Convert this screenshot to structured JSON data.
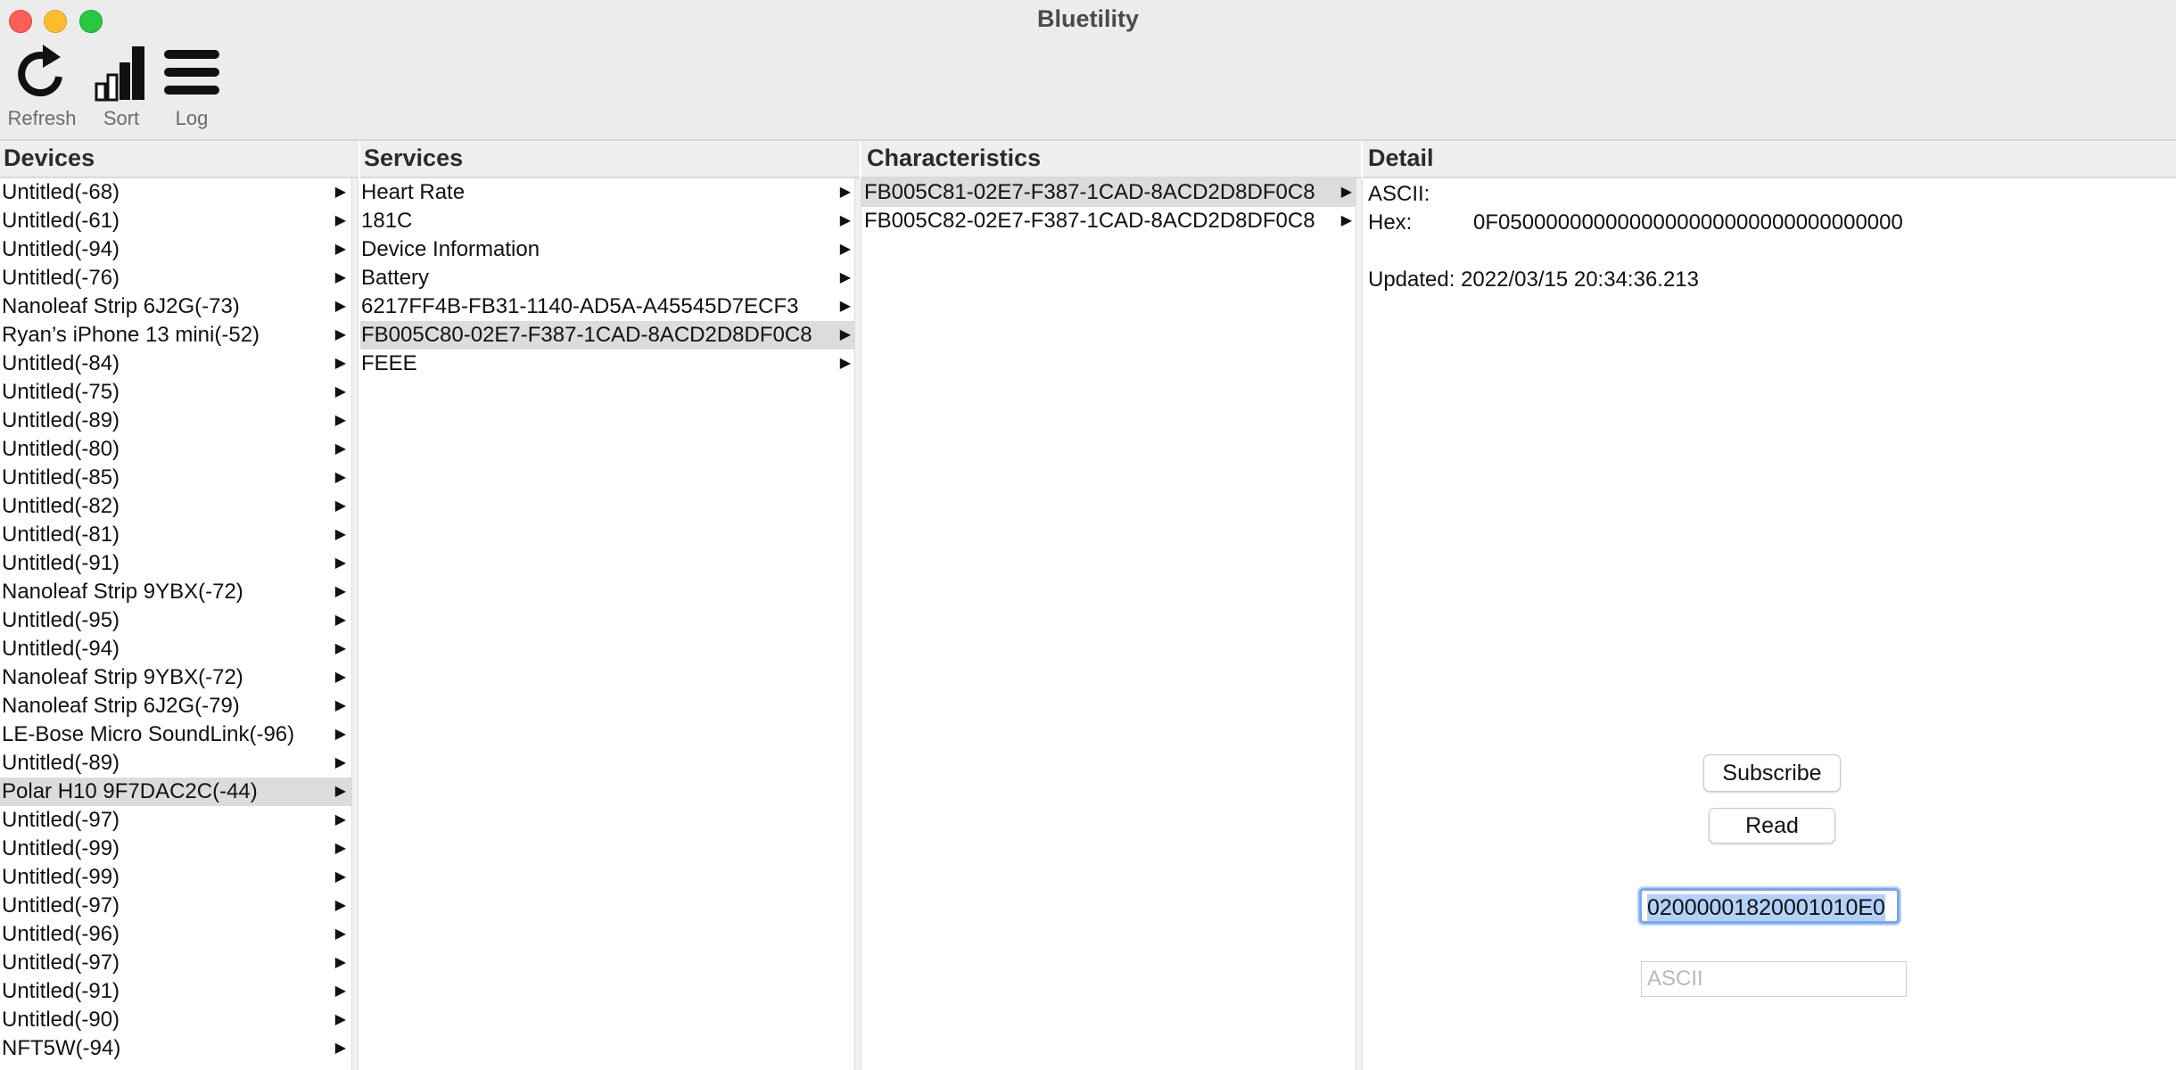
{
  "window": {
    "title": "Bluetility"
  },
  "toolbar": {
    "refresh_label": "Refresh",
    "sort_label": "Sort",
    "log_label": "Log"
  },
  "columns": {
    "devices": "Devices",
    "services": "Services",
    "characteristics": "Characteristics",
    "detail": "Detail"
  },
  "devices": [
    "Untitled(-68)",
    "Untitled(-61)",
    "Untitled(-94)",
    "Untitled(-76)",
    "Nanoleaf Strip 6J2G(-73)",
    "Ryan’s iPhone 13 mini(-52)",
    "Untitled(-84)",
    "Untitled(-75)",
    "Untitled(-89)",
    "Untitled(-80)",
    "Untitled(-85)",
    "Untitled(-82)",
    "Untitled(-81)",
    "Untitled(-91)",
    "Nanoleaf Strip 9YBX(-72)",
    "Untitled(-95)",
    "Untitled(-94)",
    "Nanoleaf Strip 9YBX(-72)",
    "Nanoleaf Strip 6J2G(-79)",
    "LE-Bose Micro SoundLink(-96)",
    "Untitled(-89)",
    "Polar H10 9F7DAC2C(-44)",
    "Untitled(-97)",
    "Untitled(-99)",
    "Untitled(-99)",
    "Untitled(-97)",
    "Untitled(-96)",
    "Untitled(-97)",
    "Untitled(-91)",
    "Untitled(-90)",
    "NFT5W(-94)"
  ],
  "devices_selected_index": 21,
  "services": [
    "Heart Rate",
    "181C",
    "Device Information",
    "Battery",
    "6217FF4B-FB31-1140-AD5A-A45545D7ECF3",
    "FB005C80-02E7-F387-1CAD-8ACD2D8DF0C8",
    "FEEE"
  ],
  "services_selected_index": 5,
  "characteristics": [
    "FB005C81-02E7-F387-1CAD-8ACD2D8DF0C8",
    "FB005C82-02E7-F387-1CAD-8ACD2D8DF0C8"
  ],
  "characteristics_selected_index": 0,
  "arrow_glyph": "▶",
  "detail": {
    "ascii_label": "ASCII:",
    "ascii_value": "",
    "hex_label": "Hex:",
    "hex_value": "0F0500000000000000000000000000000000",
    "updated_label": "Updated:",
    "updated_value": "2022/03/15 20:34:36.213",
    "subscribe_label": "Subscribe",
    "read_label": "Read",
    "write_hex_value": "02000001820001010E0",
    "write_ascii_placeholder": "ASCII"
  },
  "colors": {
    "selection": "#dcdcdc",
    "focus_ring": "#7aa6f0",
    "close": "#ff5f57",
    "minimize": "#febc2e",
    "zoom": "#28c840"
  },
  "icons": [
    "refresh-icon",
    "sort-icon",
    "log-icon"
  ]
}
